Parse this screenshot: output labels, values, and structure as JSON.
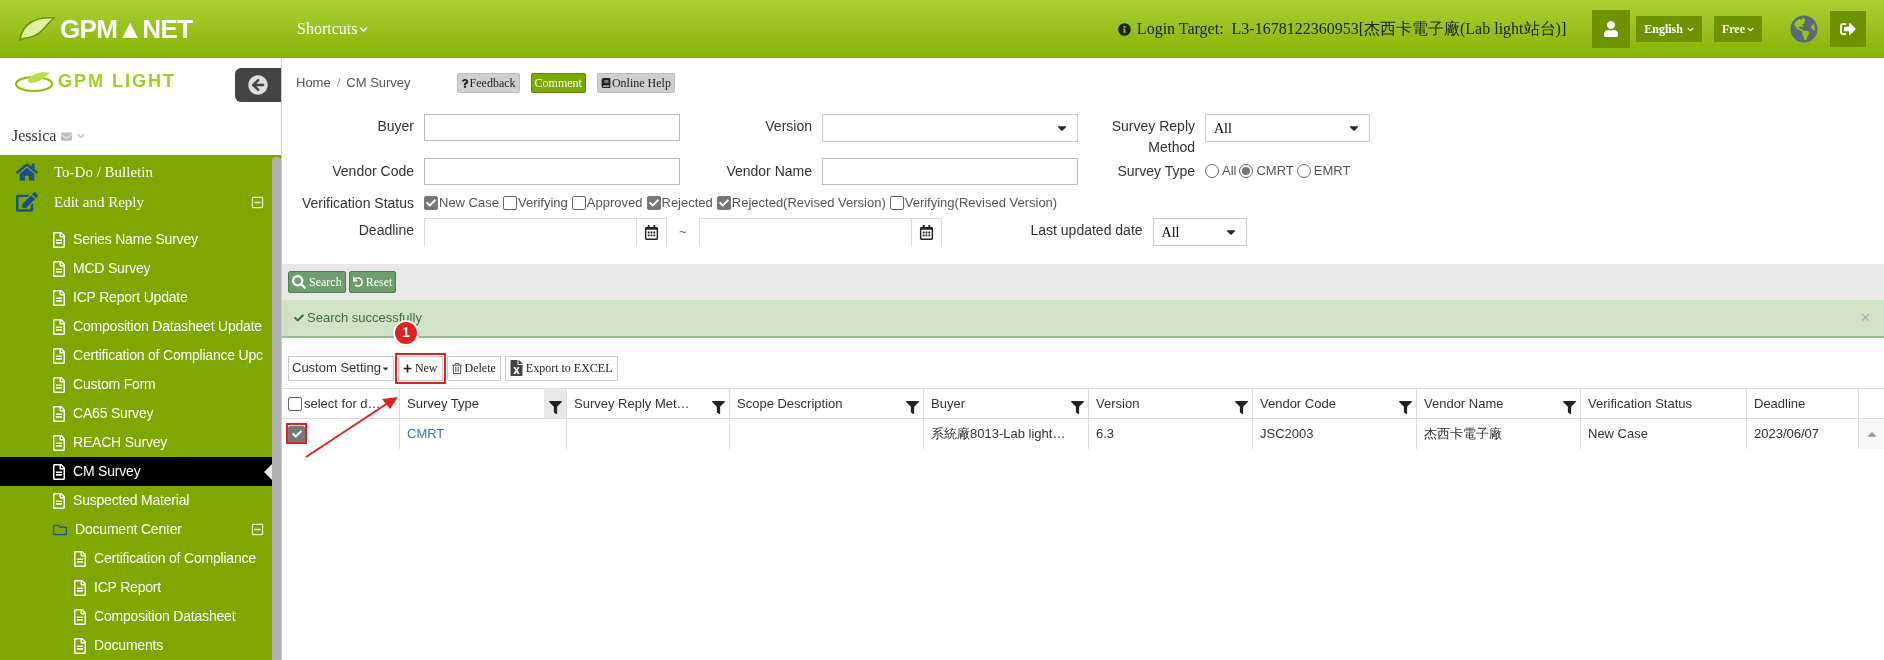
{
  "header": {
    "logo": "GPM▲NET",
    "shortcuts": "Shortcuts",
    "login_target": "Login Target:  L3-1678122360953[杰西卡電子廠(Lab light站台)]",
    "language": "English",
    "plan": "Free"
  },
  "sidebar": {
    "logo": "GPM LIGHT",
    "user": "Jessica",
    "items": [
      {
        "label": "To-Do / Bulletin",
        "kind": "home",
        "selected": false
      },
      {
        "label": "Edit and Reply",
        "kind": "edit",
        "selected": false,
        "expanded": true,
        "children": [
          {
            "label": "Series Name Survey",
            "kind": "page",
            "selected": false
          },
          {
            "label": "MCD Survey",
            "kind": "page",
            "selected": false
          },
          {
            "label": "ICP Report Update",
            "kind": "page",
            "selected": false
          },
          {
            "label": "Composition Datasheet Update",
            "kind": "page",
            "selected": false
          },
          {
            "label": "Certification of Compliance Upc",
            "kind": "page",
            "selected": false
          },
          {
            "label": "Custom Form",
            "kind": "page",
            "selected": false
          },
          {
            "label": "CA65 Survey",
            "kind": "page",
            "selected": false
          },
          {
            "label": "REACH Survey",
            "kind": "page",
            "selected": false
          },
          {
            "label": "CM Survey",
            "kind": "page",
            "selected": true
          },
          {
            "label": "Suspected Material",
            "kind": "page",
            "selected": false
          },
          {
            "label": "Document Center",
            "kind": "folder",
            "selected": false,
            "expanded": true,
            "children": [
              {
                "label": "Certification of Compliance",
                "kind": "page",
                "selected": false
              },
              {
                "label": "ICP Report",
                "kind": "page",
                "selected": false
              },
              {
                "label": "Composition Datasheet",
                "kind": "page",
                "selected": false
              },
              {
                "label": "Documents",
                "kind": "page",
                "selected": false
              }
            ]
          }
        ]
      }
    ]
  },
  "breadcrumb": {
    "items": [
      "Home",
      "CM Survey"
    ],
    "separator": "/"
  },
  "page_buttons": [
    {
      "label": "Feedback",
      "kind": "feedback"
    },
    {
      "label": "Comment",
      "kind": "comment"
    },
    {
      "label": "Online Help",
      "kind": "help"
    }
  ],
  "filters": {
    "buyer": {
      "label": "Buyer"
    },
    "version": {
      "label": "Version"
    },
    "survey_reply_method": {
      "label": "Survey Reply Method",
      "value": "All"
    },
    "vendor_code": {
      "label": "Vendor Code"
    },
    "vendor_name": {
      "label": "Vendor Name"
    },
    "survey_type": {
      "label": "Survey Type",
      "options": [
        {
          "label": "All",
          "selected": false
        },
        {
          "label": "CMRT",
          "selected": true
        },
        {
          "label": "EMRT",
          "selected": false
        }
      ]
    },
    "verification_status": {
      "label": "Verification Status",
      "options": [
        {
          "label": "New Case",
          "checked": true
        },
        {
          "label": "Verifying",
          "checked": false
        },
        {
          "label": "Approved",
          "checked": false
        },
        {
          "label": "Rejected",
          "checked": true
        },
        {
          "label": "Rejected(Revised Version)",
          "checked": true
        },
        {
          "label": "Verifying(Revised Version)",
          "checked": false
        }
      ]
    },
    "deadline": {
      "label": "Deadline",
      "separator": "~"
    },
    "last_updated": {
      "label": "Last updated date",
      "value": "All"
    }
  },
  "actions": [
    {
      "label": "Search",
      "kind": "search"
    },
    {
      "label": "Reset",
      "kind": "reset"
    }
  ],
  "alert": {
    "text": "Search successfully",
    "close": "×"
  },
  "toolbar": {
    "custom_setting": "Custom Setting",
    "buttons": [
      {
        "label": "New",
        "kind": "new"
      },
      {
        "label": "Delete",
        "kind": "delete"
      },
      {
        "label": "Export to EXCEL",
        "kind": "export"
      }
    ]
  },
  "table": {
    "select_all": {
      "label": "select for d…",
      "checked": false
    },
    "columns": [
      {
        "label": "Survey Type",
        "filter": true
      },
      {
        "label": "Survey Reply Met…",
        "filter": true
      },
      {
        "label": "Scope Description",
        "filter": true
      },
      {
        "label": "Buyer",
        "filter": true
      },
      {
        "label": "Version",
        "filter": true
      },
      {
        "label": "Vendor Code",
        "filter": true
      },
      {
        "label": "Vendor Name",
        "filter": true
      },
      {
        "label": "Verification Status",
        "filter": false
      },
      {
        "label": "Deadline",
        "filter": false
      }
    ],
    "rows": [
      {
        "checked": true,
        "cells": [
          "CMRT",
          "",
          "",
          "系統廠8013-Lab light…",
          "6.3",
          "JSC2003",
          "杰西卡電子廠",
          "New Case",
          "2023/06/07"
        ]
      }
    ]
  },
  "annotation": {
    "step": "1"
  }
}
